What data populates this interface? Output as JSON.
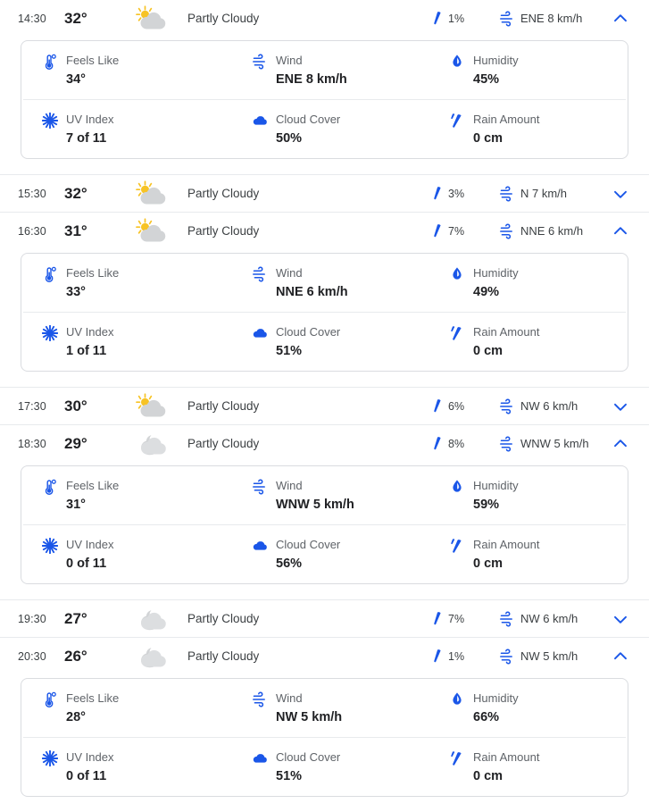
{
  "labels": {
    "feels_like": "Feels Like",
    "wind": "Wind",
    "humidity": "Humidity",
    "uv_index": "UV Index",
    "cloud_cover": "Cloud Cover",
    "rain_amount": "Rain Amount"
  },
  "colors": {
    "accent_blue": "#1a56e8",
    "icon_blue": "#1a56e8",
    "sun_yellow": "#f7c325",
    "cloud_gray": "#d2d4d6",
    "text_primary": "#202124",
    "text_secondary": "#5f6368",
    "border": "#dadce0",
    "divider": "#e8eaed"
  },
  "icons": {
    "weather_day": "sun-behind-cloud-icon",
    "weather_night": "moon-behind-cloud-icon",
    "precip": "raindrop-icon",
    "wind": "wind-icon",
    "chevron_up": "chevron-up-icon",
    "chevron_down": "chevron-down-icon",
    "feels_like": "thermometer-icon",
    "humidity": "water-drop-icon",
    "uv_index": "sun-rays-icon",
    "cloud_cover": "cloud-icon",
    "rain_amount": "rain-drops-icon"
  },
  "hours": [
    {
      "time": "14:30",
      "temp": "32°",
      "condition": "Partly Cloudy",
      "sky": "day",
      "precip": "1%",
      "wind": "ENE 8 km/h",
      "expanded": true,
      "details": {
        "feels_like": "34°",
        "wind": "ENE 8 km/h",
        "humidity": "45%",
        "uv_index": "7 of 11",
        "cloud_cover": "50%",
        "rain_amount": "0 cm"
      }
    },
    {
      "time": "15:30",
      "temp": "32°",
      "condition": "Partly Cloudy",
      "sky": "day",
      "precip": "3%",
      "wind": "N 7 km/h",
      "expanded": false,
      "details": null
    },
    {
      "time": "16:30",
      "temp": "31°",
      "condition": "Partly Cloudy",
      "sky": "day",
      "precip": "7%",
      "wind": "NNE 6 km/h",
      "expanded": true,
      "details": {
        "feels_like": "33°",
        "wind": "NNE 6 km/h",
        "humidity": "49%",
        "uv_index": "1 of 11",
        "cloud_cover": "51%",
        "rain_amount": "0 cm"
      }
    },
    {
      "time": "17:30",
      "temp": "30°",
      "condition": "Partly Cloudy",
      "sky": "day",
      "precip": "6%",
      "wind": "NW 6 km/h",
      "expanded": false,
      "details": null
    },
    {
      "time": "18:30",
      "temp": "29°",
      "condition": "Partly Cloudy",
      "sky": "night",
      "precip": "8%",
      "wind": "WNW 5 km/h",
      "expanded": true,
      "details": {
        "feels_like": "31°",
        "wind": "WNW 5 km/h",
        "humidity": "59%",
        "uv_index": "0 of 11",
        "cloud_cover": "56%",
        "rain_amount": "0 cm"
      }
    },
    {
      "time": "19:30",
      "temp": "27°",
      "condition": "Partly Cloudy",
      "sky": "night",
      "precip": "7%",
      "wind": "NW 6 km/h",
      "expanded": false,
      "details": null
    },
    {
      "time": "20:30",
      "temp": "26°",
      "condition": "Partly Cloudy",
      "sky": "night",
      "precip": "1%",
      "wind": "NW 5 km/h",
      "expanded": true,
      "details": {
        "feels_like": "28°",
        "wind": "NW 5 km/h",
        "humidity": "66%",
        "uv_index": "0 of 11",
        "cloud_cover": "51%",
        "rain_amount": "0 cm"
      }
    }
  ]
}
